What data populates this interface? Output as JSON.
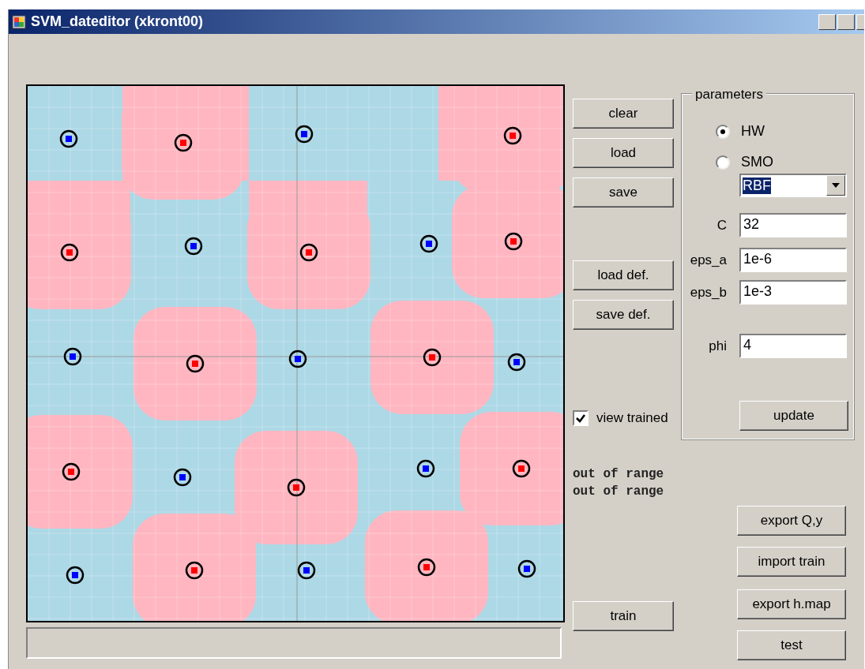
{
  "window": {
    "title": "SVM_dateditor (xkront00)"
  },
  "file_buttons": [
    "clear",
    "load",
    "save"
  ],
  "definition_buttons": [
    "load def.",
    "save def."
  ],
  "view_trained": {
    "label": "view trained",
    "checked": true
  },
  "messages": [
    "out of range",
    "out of range"
  ],
  "train_button": "train",
  "parameters": {
    "title": "parameters",
    "methods": [
      {
        "label": "HW",
        "selected": true
      },
      {
        "label": "SMO",
        "selected": false
      }
    ],
    "kernel": {
      "value": "RBF"
    },
    "fields": [
      {
        "label": "C",
        "value": "32"
      },
      {
        "label": "eps_a",
        "value": "1e-6"
      },
      {
        "label": "eps_b",
        "value": "1e-3"
      },
      {
        "label": "phi",
        "value": "4"
      }
    ],
    "update_button": "update"
  },
  "tool_buttons": [
    "export Q,y",
    "import train",
    "export h.map",
    "test"
  ]
}
